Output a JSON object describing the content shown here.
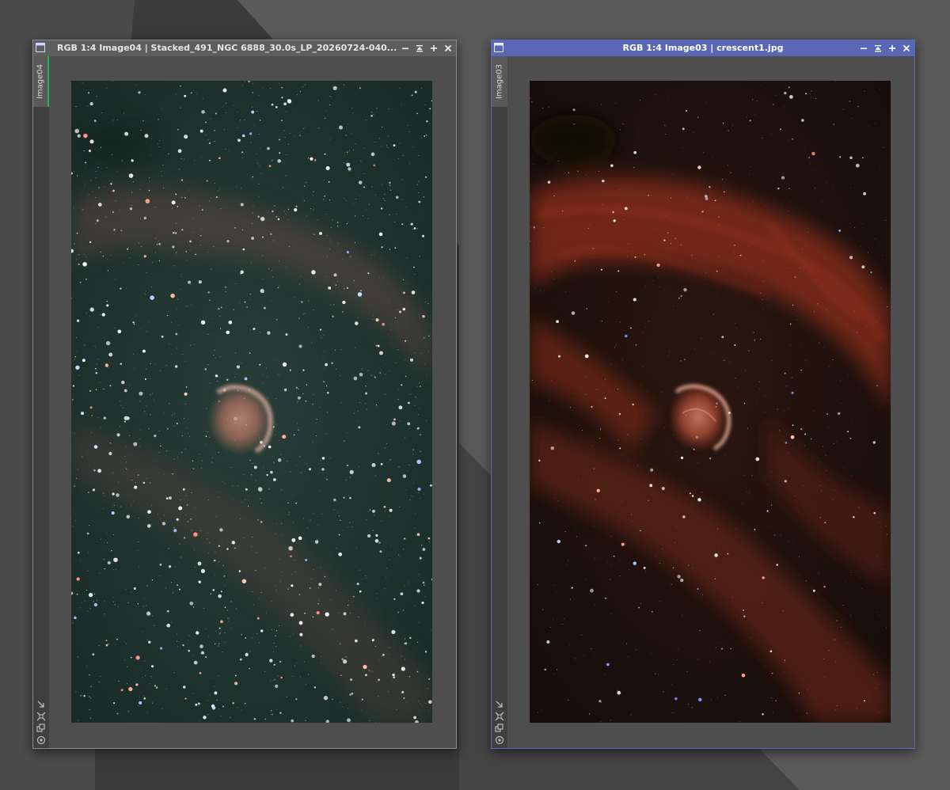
{
  "desktop": {
    "background": "#4a4a4a"
  },
  "windows": [
    {
      "id": "image04",
      "title": "RGB 1:4 Image04 | Stacked_491_NGC 6888_30.0s_LP_20260724-040...",
      "tab_label": "Image04",
      "active": false,
      "controls": [
        "minimize-icon",
        "shade-icon",
        "maximize-icon",
        "close-icon"
      ],
      "image": {
        "subject": "NGC 6888 Crescent Nebula",
        "processing": "unprocessed stack",
        "sky_tint": "#1f3a35",
        "nebula_color": "#b5735f"
      }
    },
    {
      "id": "image03",
      "title": "RGB 1:4 Image03 | crescent1.jpg",
      "tab_label": "Image03",
      "active": true,
      "controls": [
        "minimize-icon",
        "shade-icon",
        "maximize-icon",
        "close-icon"
      ],
      "image": {
        "subject": "NGC 6888 Crescent Nebula",
        "processing": "processed",
        "sky_tint": "#1a120f",
        "nebula_color": "#b03a22"
      }
    }
  ],
  "colors": {
    "active_titlebar": "#5a67b4",
    "inactive_titlebar": "#5e5e5e",
    "tab_accent": "#28b050"
  }
}
